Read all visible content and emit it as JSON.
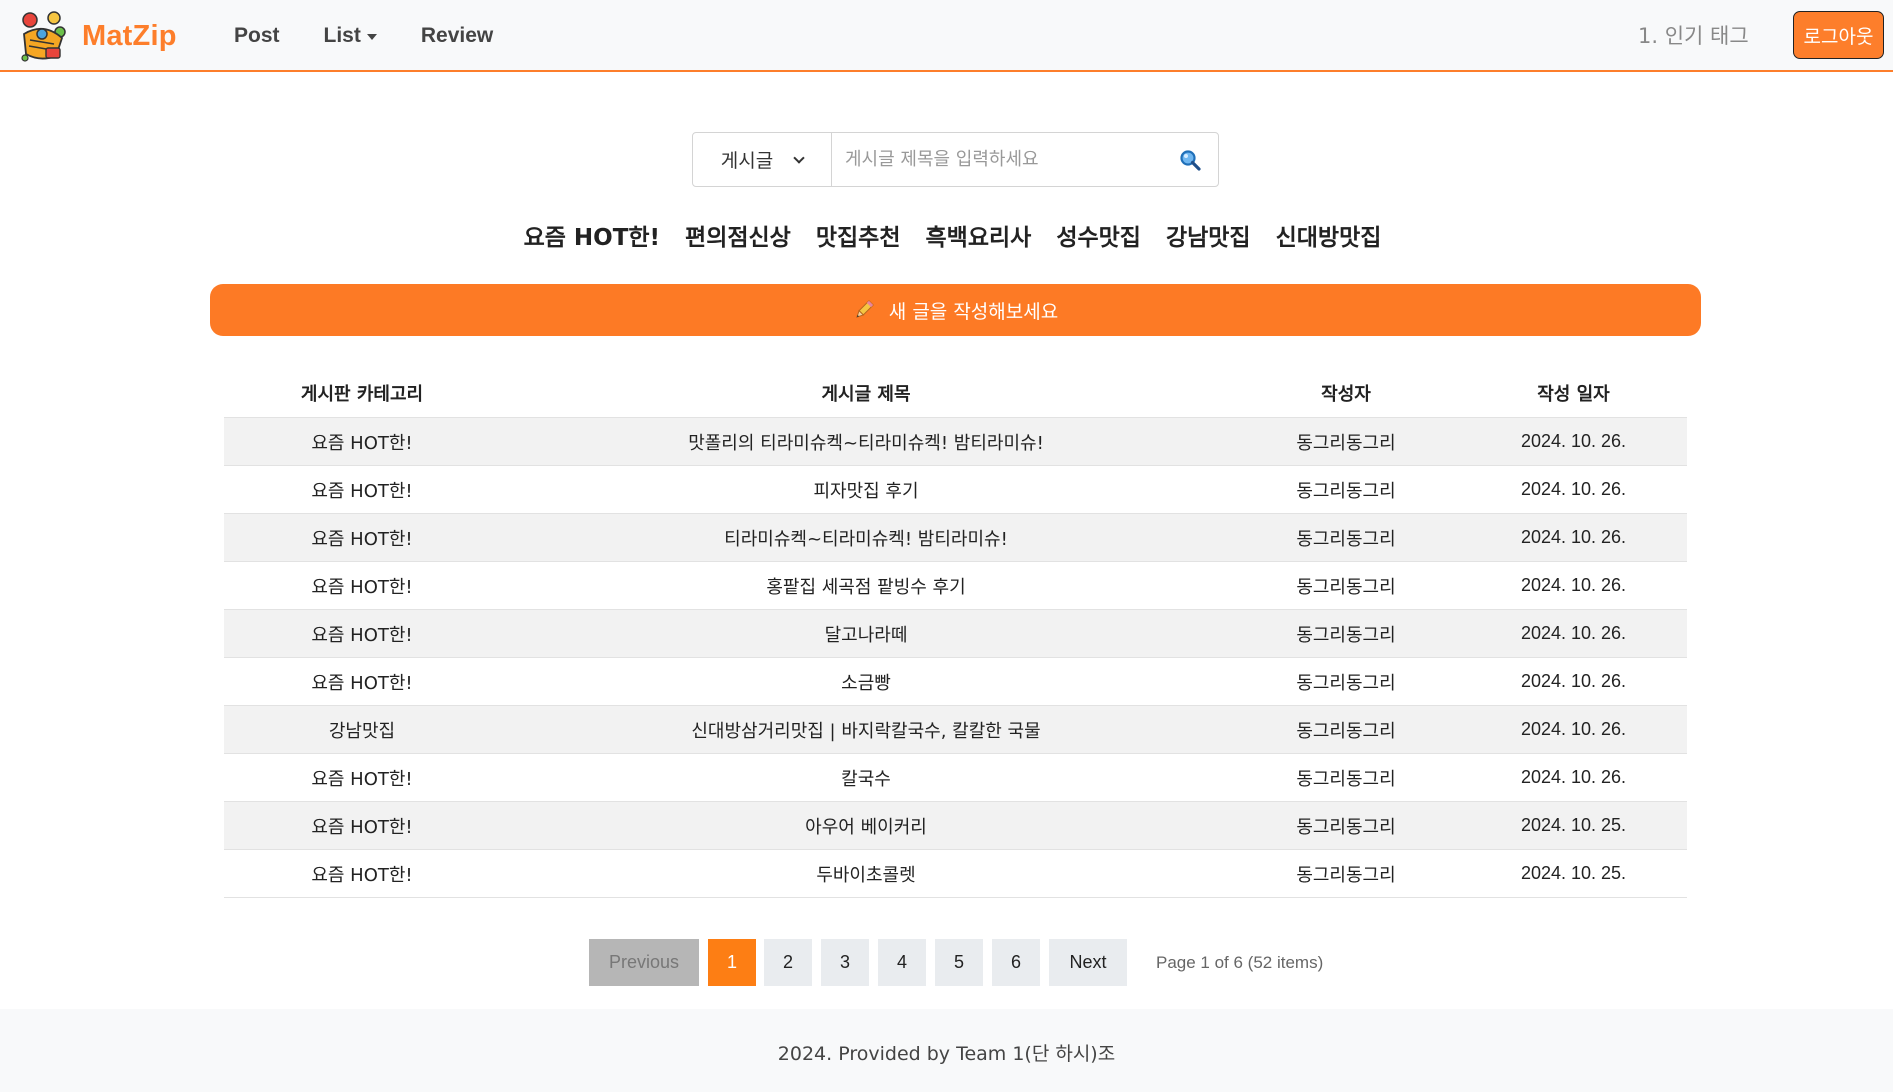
{
  "navbar": {
    "brand": "MatZip",
    "links": [
      {
        "label": "Post",
        "dropdown": false
      },
      {
        "label": "List",
        "dropdown": true
      },
      {
        "label": "Review",
        "dropdown": false
      }
    ],
    "popular_tag": "1. 인기 태그",
    "logout_label": "로그아웃",
    "logo_icon": "matzip-logo-icon",
    "accent_color": "#fd7e2b"
  },
  "search": {
    "select_value": "게시글",
    "placeholder": "게시글 제목을 입력하세요",
    "value": "",
    "icon": "search-icon"
  },
  "tags": [
    "요즘 HOT한!",
    "편의점신상",
    "맛집추천",
    "흑백요리사",
    "성수맛집",
    "강남맛집",
    "신대방맛집"
  ],
  "new_post": {
    "label": "새 글을 작성해보세요",
    "icon": "pencil-icon"
  },
  "table": {
    "headers": [
      "게시판 카테고리",
      "게시글 제목",
      "작성자",
      "작성 일자"
    ],
    "rows": [
      [
        "요즘 HOT한!",
        "맛폴리의 티라미슈켁~티라미슈켁! 밤티라미슈!",
        "동그리동그리",
        "2024. 10. 26."
      ],
      [
        "요즘 HOT한!",
        "피자맛집 후기",
        "동그리동그리",
        "2024. 10. 26."
      ],
      [
        "요즘 HOT한!",
        "티라미슈켁~티라미슈켁! 밤티라미슈!",
        "동그리동그리",
        "2024. 10. 26."
      ],
      [
        "요즘 HOT한!",
        "홍팥집 세곡점 팥빙수 후기",
        "동그리동그리",
        "2024. 10. 26."
      ],
      [
        "요즘 HOT한!",
        "달고나라떼",
        "동그리동그리",
        "2024. 10. 26."
      ],
      [
        "요즘 HOT한!",
        "소금빵",
        "동그리동그리",
        "2024. 10. 26."
      ],
      [
        "강남맛집",
        "신대방삼거리맛집 | 바지락칼국수, 칼칼한 국물",
        "동그리동그리",
        "2024. 10. 26."
      ],
      [
        "요즘 HOT한!",
        "칼국수",
        "동그리동그리",
        "2024. 10. 26."
      ],
      [
        "요즘 HOT한!",
        "아우어 베이커리",
        "동그리동그리",
        "2024. 10. 25."
      ],
      [
        "요즘 HOT한!",
        "두바이초콜렛",
        "동그리동그리",
        "2024. 10. 25."
      ]
    ]
  },
  "pagination": {
    "previous_label": "Previous",
    "next_label": "Next",
    "pages": [
      "1",
      "2",
      "3",
      "4",
      "5",
      "6"
    ],
    "current_page": 1,
    "info": "Page 1 of 6 (52 items)"
  },
  "footer": {
    "text": "2024. Provided by Team 1(단 하시)조"
  }
}
